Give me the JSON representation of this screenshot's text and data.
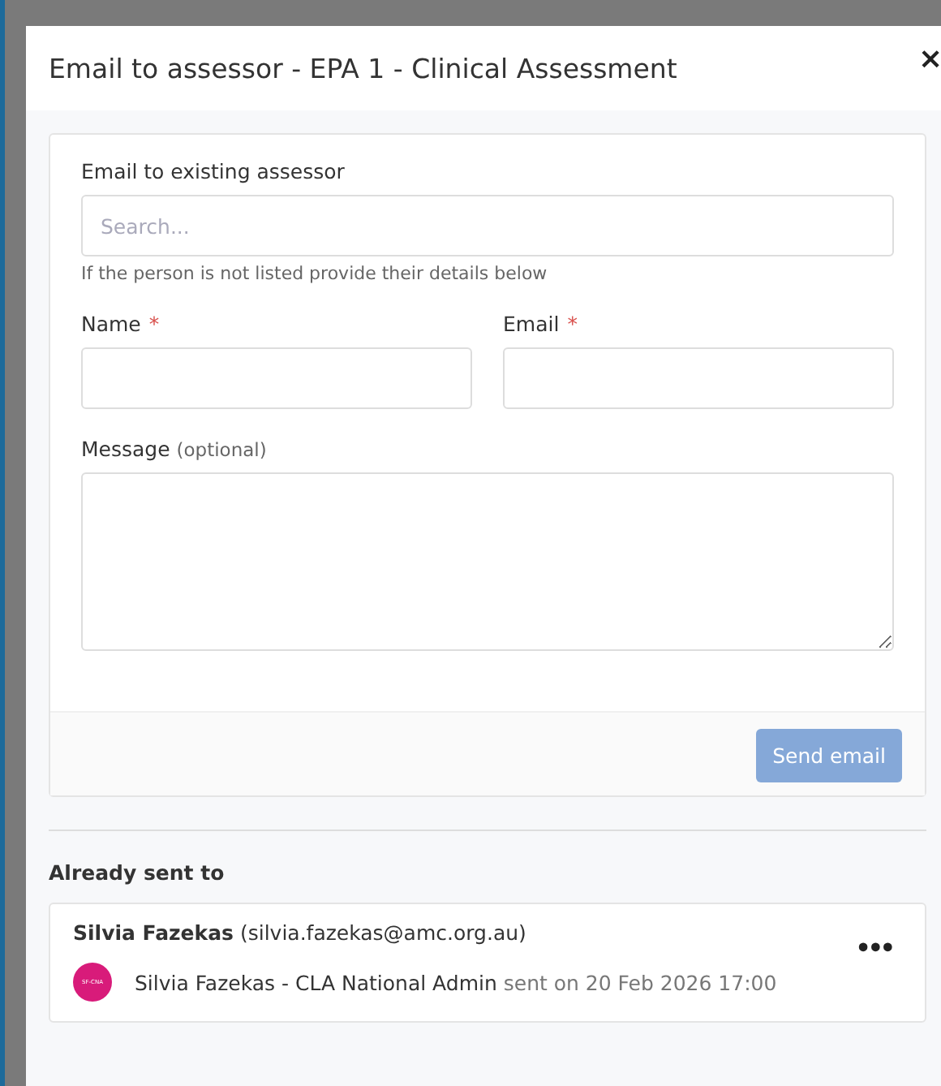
{
  "modal": {
    "title": "Email to assessor - EPA 1 - Clinical Assessment",
    "close": "×"
  },
  "form": {
    "search": {
      "label": "Email to existing assessor",
      "placeholder": "Search...",
      "help": "If the person is not listed provide their details below"
    },
    "fields": [
      {
        "label": "Name",
        "required_mark": "*"
      },
      {
        "label": "Email",
        "required_mark": "*"
      }
    ],
    "message": {
      "label": "Message",
      "hint": "(optional)"
    },
    "send_button": {
      "label": "Send email",
      "disabled": true
    }
  },
  "sent": {
    "heading": "Already sent to",
    "items": [
      {
        "name": "Silvia Fazekas",
        "email": "(silvia.fazekas@amc.org.au)",
        "menu": "•••",
        "avatar": {
          "initials": "SF-CNA",
          "color": "#d81b7a"
        },
        "sender": "Silvia Fazekas - CLA National Admin",
        "sent_on": "sent on 20 Feb 2026 17:00"
      }
    ]
  }
}
